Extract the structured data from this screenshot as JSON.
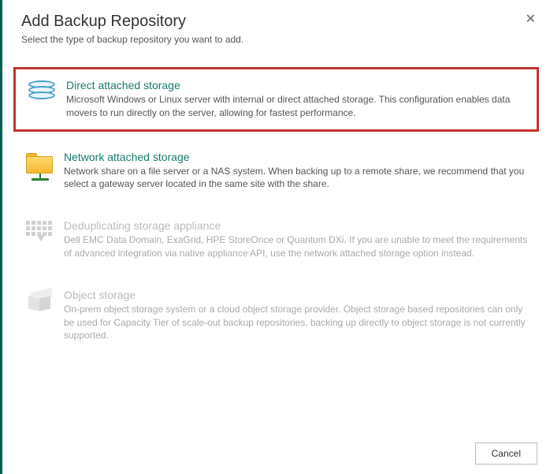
{
  "header": {
    "title": "Add Backup Repository",
    "subtitle": "Select the type of backup repository you want to add."
  },
  "options": {
    "direct_attached": {
      "title": "Direct attached storage",
      "desc": "Microsoft Windows or Linux server with internal or direct attached storage. This configuration enables data movers to run directly on the server, allowing for fastest performance."
    },
    "network_attached": {
      "title": "Network attached storage",
      "desc": "Network share on a file server or a NAS system. When backing up to a remote share, we recommend that you select a gateway server located in the same site with the share."
    },
    "dedupe": {
      "title": "Deduplicating storage appliance",
      "desc": "Dell EMC Data Domain, ExaGrid, HPE StoreOnce or Quantum DXi. If you are unable to meet the requirements of advanced integration via native appliance API, use the network attached storage option instead."
    },
    "object": {
      "title": "Object storage",
      "desc": "On-prem object storage system or a cloud object storage provider. Object storage based repositories can only be used for Capacity Tier of scale-out backup repositories, backing up directly to object storage is not currently supported."
    }
  },
  "footer": {
    "cancel_label": "Cancel"
  }
}
